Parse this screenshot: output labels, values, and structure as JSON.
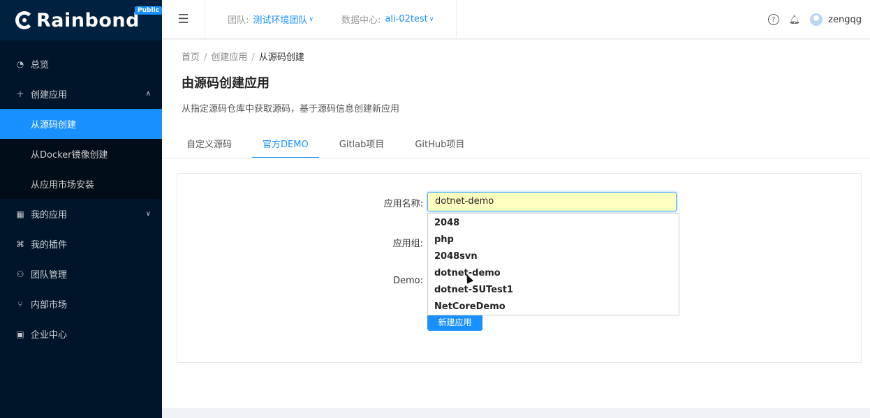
{
  "brand": {
    "name": "Rainbond",
    "badge": "Public"
  },
  "sidebar": {
    "items": [
      {
        "label": "总览",
        "icon": "dashboard-icon"
      },
      {
        "label": "创建应用",
        "icon": "plus-icon",
        "arrow": "∧"
      },
      {
        "label": "从源码创建",
        "active": true
      },
      {
        "label": "从Docker镜像创建"
      },
      {
        "label": "从应用市场安装"
      },
      {
        "label": "我的应用",
        "icon": "apps-icon",
        "arrow": "∨"
      },
      {
        "label": "我的插件",
        "icon": "plugin-icon"
      },
      {
        "label": "团队管理",
        "icon": "team-icon"
      },
      {
        "label": "内部市场",
        "icon": "market-icon"
      },
      {
        "label": "企业中心",
        "icon": "enterprise-icon"
      }
    ]
  },
  "header": {
    "team_label": "团队:",
    "team_value": "测试环境团队",
    "dc_label": "数据中心:",
    "dc_value": "ali-02test",
    "username": "zengqg"
  },
  "page": {
    "breadcrumb": [
      "首页",
      "创建应用",
      "从源码创建"
    ],
    "title": "由源码创建应用",
    "description": "从指定源码仓库中获取源码，基于源码信息创建新应用",
    "tabs": [
      "自定义源码",
      "官方DEMO",
      "Gitlab项目",
      "GitHub项目"
    ],
    "active_tab": 1
  },
  "form": {
    "app_name_label": "应用名称:",
    "app_name_value": "dotnet-demo",
    "group_label": "应用组:",
    "demo_label": "Demo:",
    "submit_label": "新建应用",
    "suggestions": [
      "2048",
      "php",
      "2048svn",
      "dotnet-demo",
      "dotnet-SUTest1",
      "NetCoreDemo"
    ]
  },
  "colors": {
    "primary": "#1890ff",
    "sidebar_bg": "#001529"
  }
}
